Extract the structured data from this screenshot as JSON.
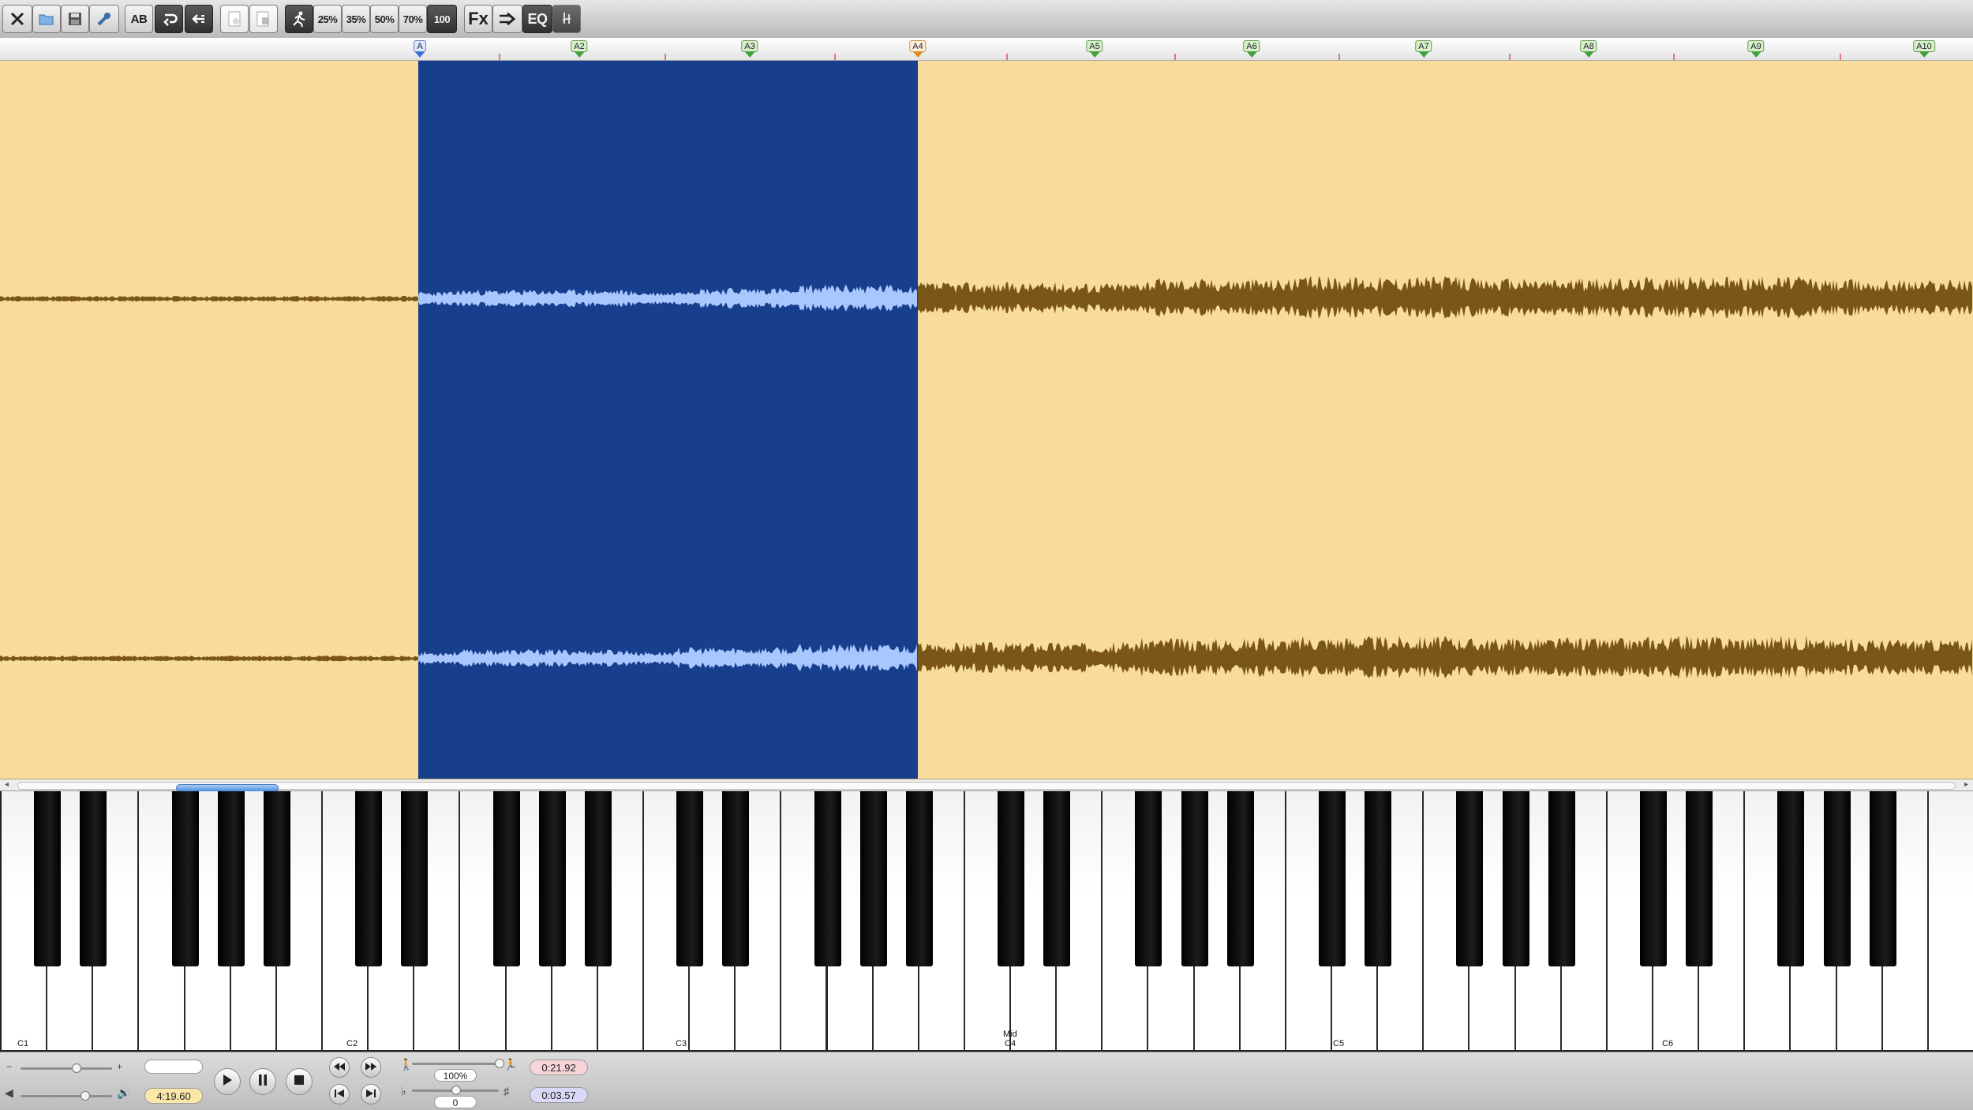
{
  "toolbar": {
    "ab_label": "AB",
    "speed_presets": [
      "25%",
      "35%",
      "50%",
      "70%",
      "100"
    ],
    "fx_label": "Fx",
    "eq_label": "EQ"
  },
  "ruler": {
    "markers": [
      "A",
      "A2",
      "A3",
      "A4",
      "A5",
      "A6",
      "A7",
      "A8",
      "A9",
      "A10"
    ]
  },
  "colors": {
    "waveform_background": "#f8dc9b",
    "waveform": "#7a5618",
    "selection_background": "#183f8d",
    "selection_waveform": "#a9c7ff"
  },
  "piano": {
    "labels": {
      "c1": "C1",
      "c2": "C2",
      "c3": "C3",
      "c4_mid": "Mid",
      "c4": "C4",
      "c5": "C5",
      "c6": "C6"
    }
  },
  "bottom": {
    "search_placeholder": "",
    "total_time": "4:19.60",
    "speed_value": "100%",
    "pitch_value": "0",
    "current_time": "0:21.92",
    "selection_length": "0:03.57",
    "zoom_level": 0.6,
    "volume_level": 0.7,
    "speed_level": 1.0,
    "pitch_level": 0.5
  },
  "icons": {
    "close": "close-icon",
    "open": "folder-open-icon",
    "save": "save-icon",
    "tools": "wrench-icon",
    "loop": "loop-icon",
    "back": "back-icon",
    "page": "page-icon",
    "page_edit": "page-edit-icon",
    "run": "runner-icon",
    "forward": "arrow-forward-icon",
    "tuner": "tuner-icon"
  }
}
